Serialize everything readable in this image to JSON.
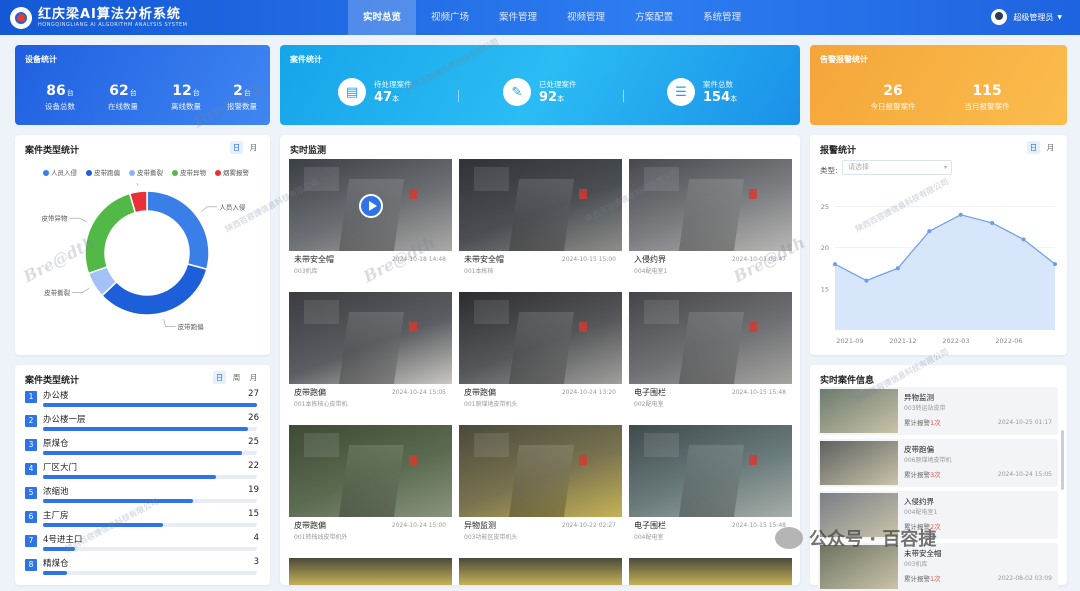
{
  "app": {
    "title": "红庆梁AI算法分析系统",
    "subtitle": "HONGQINGLIANG AI ALGORITHM ANALYSIS SYSTEM"
  },
  "nav": [
    {
      "label": "实时总览",
      "active": true
    },
    {
      "label": "视频广场",
      "active": false
    },
    {
      "label": "案件管理",
      "active": false
    },
    {
      "label": "视频管理",
      "active": false
    },
    {
      "label": "方案配置",
      "active": false
    },
    {
      "label": "系统管理",
      "active": false
    }
  ],
  "user": {
    "name": "超级管理员"
  },
  "device_stats": {
    "title": "设备统计",
    "items": [
      {
        "value": "86",
        "unit": "台",
        "label": "设备总数"
      },
      {
        "value": "62",
        "unit": "台",
        "label": "在线数量"
      },
      {
        "value": "12",
        "unit": "台",
        "label": "离线数量"
      },
      {
        "value": "2",
        "unit": "台",
        "label": "报警数量"
      }
    ]
  },
  "case_stats": {
    "title": "案件统计",
    "items": [
      {
        "label": "待处理案件",
        "value": "47",
        "unit": "本"
      },
      {
        "label": "已处理案件",
        "value": "92",
        "unit": "本"
      },
      {
        "label": "案件总数",
        "value": "154",
        "unit": "本"
      }
    ]
  },
  "alarm_stats": {
    "title": "告警报警统计",
    "items": [
      {
        "value": "26",
        "label": "今日报警案件"
      },
      {
        "value": "115",
        "label": "当月报警案件"
      }
    ]
  },
  "case_type_chart": {
    "title": "案件类型统计",
    "toggle": [
      "日",
      "月"
    ],
    "legend": [
      {
        "name": "人员入侵",
        "color": "#3a7ee8"
      },
      {
        "name": "皮带跑偏",
        "color": "#1d5fd8"
      },
      {
        "name": "皮带撕裂",
        "color": "#8fb3f5"
      },
      {
        "name": "皮带异物",
        "color": "#52b947"
      },
      {
        "name": "烟雾报警",
        "color": "#e8303a"
      }
    ],
    "labels": [
      "人员入侵",
      "皮带跑偏",
      "皮带撕裂",
      "皮带异物",
      "烟雾报警"
    ]
  },
  "chart_data": {
    "type": "pie",
    "categories": [
      "人员入侵",
      "皮带跑偏",
      "皮带撕裂",
      "皮带异物",
      "烟雾报警"
    ],
    "values": [
      26,
      30,
      6,
      23,
      4
    ],
    "colors": [
      "#3a7ee8",
      "#1d5fd8",
      "#a3c1f7",
      "#52b947",
      "#e8303a"
    ]
  },
  "alarm_chart": {
    "title": "报警统计",
    "toggle": [
      "日",
      "月"
    ],
    "type_label": "类型:",
    "type_placeholder": "请选择",
    "x": [
      "2021-09",
      "2021-12",
      "2022-03",
      "2022-06",
      ""
    ],
    "y_ticks": [
      "25",
      "20",
      "15"
    ],
    "values": [
      18,
      16,
      17.5,
      22,
      24,
      23,
      21,
      18
    ]
  },
  "ranking": {
    "title": "案件类型统计",
    "toggle": [
      "日",
      "周",
      "月"
    ],
    "rows": [
      {
        "rank": "1",
        "name": "办公楼",
        "value": "27"
      },
      {
        "rank": "2",
        "name": "办公楼一层",
        "value": "26"
      },
      {
        "rank": "3",
        "name": "原煤仓",
        "value": "25"
      },
      {
        "rank": "4",
        "name": "厂区大门",
        "value": "22"
      },
      {
        "rank": "5",
        "name": "浓缩池",
        "value": "19"
      },
      {
        "rank": "6",
        "name": "主厂房",
        "value": "15"
      },
      {
        "rank": "7",
        "name": "4号进主口",
        "value": "4"
      },
      {
        "rank": "8",
        "name": "精煤仓",
        "value": "3"
      }
    ]
  },
  "monitor": {
    "title": "实时监测",
    "videos": [
      {
        "caption": "未带安全帽",
        "sub": "003机库",
        "time": "2024-10-18 14:48"
      },
      {
        "caption": "未带安全帽",
        "sub": "001本栋核",
        "time": "2024-10-15 15:00"
      },
      {
        "caption": "入侵约界",
        "sub": "004配电室1",
        "time": "2024-10-03 03:47"
      },
      {
        "caption": "皮带跑偏",
        "sub": "001本栋核心皮带机",
        "time": "2024-10-24 15:05"
      },
      {
        "caption": "皮带跑偏",
        "sub": "001原煤地皮带机头",
        "time": "2024-10-24 13:20"
      },
      {
        "caption": "电子围栏",
        "sub": "002配电室",
        "time": "2024-10-15 15:48"
      },
      {
        "caption": "皮带跑偏",
        "sub": "001转栈线皮带机外",
        "time": "2024-10-24 15:00"
      },
      {
        "caption": "异物监测",
        "sub": "003功能区皮带机头",
        "time": "2024-10-22 02:27"
      },
      {
        "caption": "电子围栏",
        "sub": "004配电室",
        "time": "2024-10-15 15:48"
      }
    ]
  },
  "realtime": {
    "title": "实时案件信息",
    "items": [
      {
        "type": "异物监测",
        "loc": "003转运站皮带",
        "count_label": "累计报警",
        "count": "1次",
        "time": "2024-10-25 01:17"
      },
      {
        "type": "皮带跑偏",
        "loc": "006原煤地皮带机",
        "count_label": "累计报警",
        "count": "3次",
        "time": "2024-10-24 15:05"
      },
      {
        "type": "入侵约界",
        "loc": "004配电室1",
        "count_label": "累计报警",
        "count": "2次",
        "time": ""
      },
      {
        "type": "未带安全帽",
        "loc": "003机库",
        "count_label": "累计报警",
        "count": "1次",
        "time": "2022-08-02 03:09"
      }
    ]
  },
  "watermark": {
    "brand": "Bre@dth",
    "company": "陕西百容捷信息科技有限公司",
    "wechat": "公众号 · 百容捷"
  }
}
